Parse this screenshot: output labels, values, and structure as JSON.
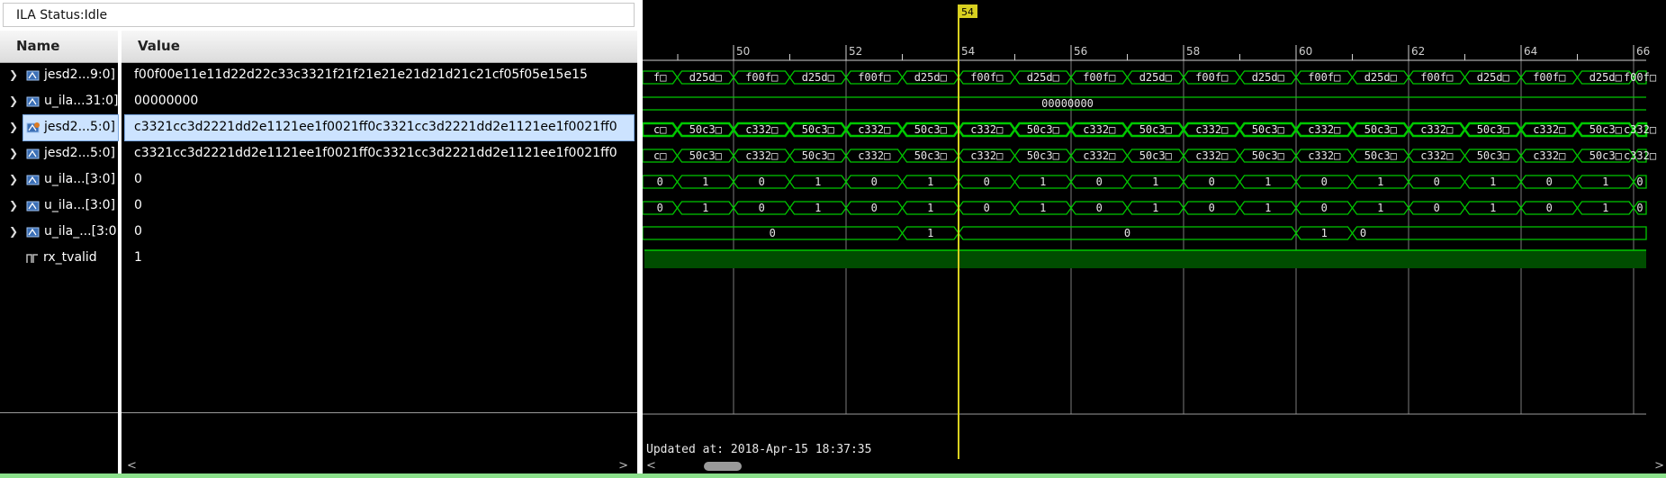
{
  "status": {
    "label": "ILA Status:Idle"
  },
  "columns": {
    "name": "Name",
    "value": "Value"
  },
  "signals": [
    {
      "name": "jesd2...9:0]",
      "value": "f00f00e11e11d22d22c33c3321f21f21e21e21d21d21c21cf05f05e15e15",
      "icon": "bus-icon",
      "expand": true,
      "selected": false
    },
    {
      "name": "u_ila...31:0]",
      "value": "00000000",
      "icon": "bus-icon",
      "expand": true,
      "selected": false
    },
    {
      "name": "jesd2...5:0]",
      "value": "c3321cc3d2221dd2e1121ee1f0021ff0c3321cc3d2221dd2e1121ee1f0021ff0",
      "icon": "bus-trigger-icon",
      "expand": true,
      "selected": true
    },
    {
      "name": "jesd2...5:0]",
      "value": "c3321cc3d2221dd2e1121ee1f0021ff0c3321cc3d2221dd2e1121ee1f0021ff0",
      "icon": "bus-icon",
      "expand": true,
      "selected": false
    },
    {
      "name": "u_ila...[3:0]",
      "value": "0",
      "icon": "bus-icon",
      "expand": true,
      "selected": false
    },
    {
      "name": "u_ila...[3:0]",
      "value": "0",
      "icon": "bus-icon",
      "expand": true,
      "selected": false
    },
    {
      "name": "u_ila_...[3:0]",
      "value": "0",
      "icon": "bus-icon",
      "expand": true,
      "selected": false
    },
    {
      "name": "rx_tvalid",
      "value": "1",
      "icon": "bit-icon",
      "expand": false,
      "selected": false
    }
  ],
  "waveform": {
    "cursor_label": "54",
    "ruler_labels": [
      "50",
      "52",
      "54",
      "56",
      "58",
      "60",
      "62",
      "64",
      "66"
    ],
    "rows": [
      {
        "type": "alt",
        "first": "f□",
        "a": "d25d□",
        "b": "f00f□"
      },
      {
        "type": "const",
        "text": "00000000"
      },
      {
        "type": "alt",
        "first": "c□",
        "a": "50c3□",
        "b": "c332□",
        "highlight": true
      },
      {
        "type": "alt",
        "first": "c□",
        "a": "50c3□",
        "b": "c332□"
      },
      {
        "type": "alt",
        "first": "0",
        "a": "1",
        "b": "0"
      },
      {
        "type": "alt",
        "first": "0",
        "a": "1",
        "b": "0"
      },
      {
        "type": "pulse",
        "text0": "0",
        "text1": "1",
        "text0b": "0",
        "text1b": "1",
        "text0c": "0"
      },
      {
        "type": "bit"
      }
    ],
    "updated": "Updated at: 2018-Apr-15 18:37:35"
  },
  "colors": {
    "wave": "#00c800",
    "cursor": "#d8d020",
    "grid": "#7a7a7a",
    "bit_fill": "#004d00",
    "selection": "#cce3ff"
  },
  "scroll": {
    "left_arrow": "<",
    "right_arrow": ">"
  }
}
